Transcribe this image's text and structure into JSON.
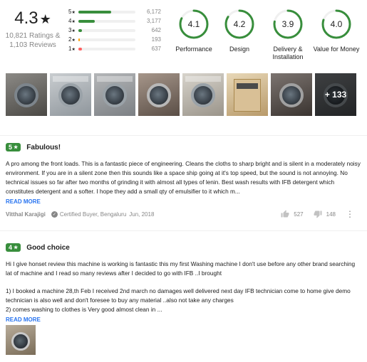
{
  "summary": {
    "overall_score": "4.3",
    "ratings_text": "10,821 Ratings &",
    "reviews_text": "1,103 Reviews",
    "distribution": [
      {
        "stars": "5",
        "count": "6,172",
        "fraction": 0.57,
        "color": "#388e3c"
      },
      {
        "stars": "4",
        "count": "3,177",
        "fraction": 0.29,
        "color": "#388e3c"
      },
      {
        "stars": "3",
        "count": "642",
        "fraction": 0.06,
        "color": "#388e3c"
      },
      {
        "stars": "2",
        "count": "193",
        "fraction": 0.02,
        "color": "#ff9f00"
      },
      {
        "stars": "1",
        "count": "637",
        "fraction": 0.06,
        "color": "#ff6161"
      }
    ],
    "aspects": [
      {
        "value": "4.1",
        "score": 4.1,
        "label": "Performance"
      },
      {
        "value": "4.2",
        "score": 4.2,
        "label": "Design"
      },
      {
        "value": "3.9",
        "score": 3.9,
        "label": "Delivery & Installation"
      },
      {
        "value": "4.0",
        "score": 4.0,
        "label": "Value for Money"
      }
    ],
    "accent_color": "#388e3c"
  },
  "photos": {
    "more_label": "+ 133"
  },
  "reviews": [
    {
      "rating": "5",
      "title": "Fabulous!",
      "body": [
        "A pro among the front loads. This is a fantastic piece of engineering. Cleans the cloths to sharp bright and is silent in a moderately noisy environment. If you are in a silent zone then this sounds like a space ship going at it's top speed, but the sound is not annoying. No technical issues so far after two months of grinding it with almost all types of lenin. Best wash results with IFB detergent which constitutes detergent and a softer. I hope they add a small qty of emulsifier to it which m..."
      ],
      "read_more": "READ MORE",
      "author": "Vitthal Karajigi",
      "certified": "Certified Buyer, Bengaluru",
      "date": "Jun, 2018",
      "likes": "527",
      "dislikes": "148"
    },
    {
      "rating": "4",
      "title": "Good choice",
      "body": [
        "Hi I give honset review this machine is working is fantastic this my first Washing machine I don't use before any other brand searching lat of machine and I read so many reviews after I decided to go with IFB ..I brought",
        "1) I booked a machine 28,th Feb I received 2nd march no damages well delivered next day IFB technician come to home give demo technician is also well and don't foresee to buy any material ..also not take any charges",
        "2) comes washing to clothes is Very good almost clean in ..."
      ],
      "read_more": "READ MORE"
    }
  ]
}
